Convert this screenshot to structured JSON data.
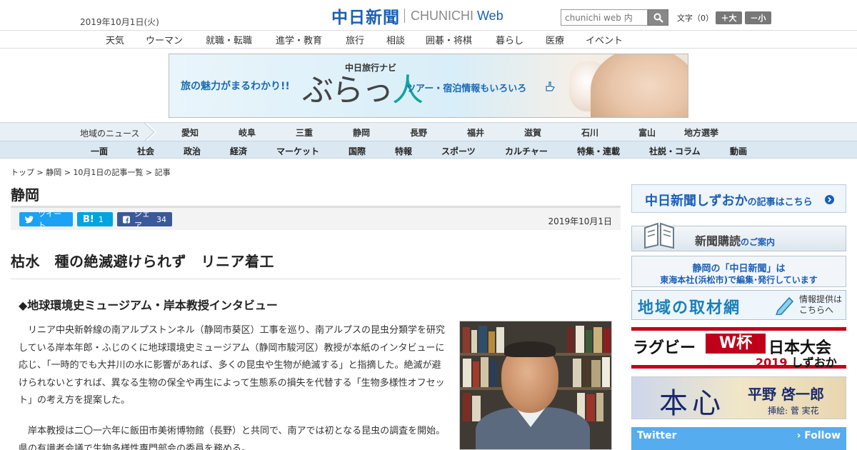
{
  "header": {
    "date": "2019年10月1日(火)",
    "logo_jp": "中日新聞",
    "logo_en_gray": "CHUNICHI",
    "logo_en_blue": "Web",
    "search_placeholder": "chunichi web 内",
    "font_label": "文字（0）",
    "font_up": "＋大",
    "font_down": "－小"
  },
  "top_nav": [
    "天気",
    "ウーマン",
    "就職・転職",
    "進学・教育",
    "旅行",
    "相談",
    "囲碁・将棋",
    "暮らし",
    "医療",
    "イベント"
  ],
  "ad": {
    "left_text": "旅の魅力がまるわかり!!",
    "nav_label": "中日旅行ナビ",
    "brand_a": "ぶらっ",
    "brand_b": "人",
    "right_text": "ツアー・宿泊情報もいろいろ"
  },
  "region_nav": {
    "label": "地域のニュース",
    "items": [
      "愛知",
      "岐阜",
      "三重",
      "静岡",
      "長野",
      "福井",
      "滋賀",
      "石川",
      "富山",
      "地方選挙"
    ]
  },
  "main_nav": [
    "一面",
    "社会",
    "政治",
    "経済",
    "マーケット",
    "国際",
    "特報",
    "スポーツ",
    "カルチャー",
    "特集・連載",
    "社説・コラム",
    "動画"
  ],
  "breadcrumb": "トップ > 静岡 > 10月1日の記事一覧 > 記事",
  "section_title": "静岡",
  "share": {
    "tweet": "ツイート",
    "hatena_label": "B!",
    "hatena_count": "1",
    "facebook": "シェア",
    "facebook_count": "34",
    "date": "2019年10月1日"
  },
  "article": {
    "headline": "枯水　種の絶滅避けられず　リニア着工",
    "subhead": "◆地球環境史ミュージアム・岸本教授インタビュー",
    "para1": "リニア中央新幹線の南アルプストンネル（静岡市葵区）工事を巡り、南アルプスの昆虫分類学を研究している岸本年郎・ふじのくに地球環境史ミュージアム（静岡市駿河区）教授が本紙のインタビューに応じ、「一時的でも大井川の水に影響があれば、多くの昆虫や生物が絶滅する」と指摘した。絶滅が避けられないとすれば、異なる生物の保全や再生によって生態系の損失を代替する「生物多様性オフセット」の考え方を提案した。",
    "para2": "岸本教授は二〇一六年に飯田市美術博物館（長野）と共同で、南アでは初となる昆虫の調査を開始。県の有識者会議で生物多様性専門部会の委員を務める。"
  },
  "sidebar": {
    "shizuoka_main": "中日新聞しずおか",
    "shizuoka_sub": "の記事はこちら",
    "subscribe_main": "新聞購読",
    "subscribe_sub": "のご案内",
    "hq_line1": "静岡の「中日新聞」は",
    "hq_line2": "東海本社(浜松市)で編集･発行しています",
    "network_main": "地域の取材網",
    "network_sub1": "情報提供は",
    "network_sub2": "こちらへ",
    "rugby_a": "ラグビー",
    "rugby_w": "W杯",
    "rugby_b": "日本大会",
    "rugby_year": "2019",
    "rugby_city": "しずおか",
    "honshin_title": "本心",
    "honshin_author": "平野 啓一郎",
    "honshin_art": "挿絵: 菅 実花",
    "twitter": "Twitter",
    "follow": "Follow"
  },
  "colors": {
    "brand_blue": "#1a5fb4",
    "twitter": "#1da1f2",
    "hatena": "#00a4de",
    "facebook": "#3b5998",
    "rugby_red": "#c0001a"
  }
}
